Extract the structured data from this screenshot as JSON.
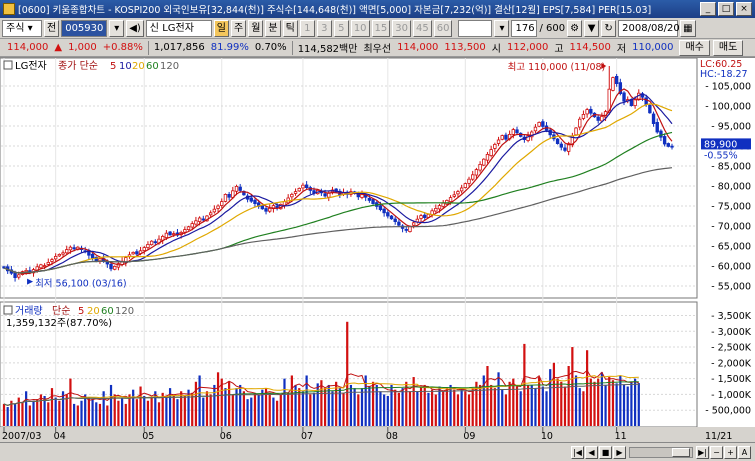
{
  "window": {
    "title": "[0600] 키움종합차트 - KOSPI200 외국인보유[32,844(천)] 주식수[144,648(천)] 액면[5,000] 자본금[7,232(억)] 결산[12월] EPS[7,584] PER[15.03]",
    "buttons": [
      "_",
      "□",
      "×"
    ]
  },
  "toolbar": {
    "market": "주식",
    "search_label": "전",
    "code": "005930",
    "stock_name_tag": "신",
    "stock_name": "LG전자",
    "period_sel": "일",
    "period_buttons": [
      "주",
      "월",
      "분",
      "틱"
    ],
    "minute_buttons": [
      "1",
      "3",
      "5",
      "10",
      "15",
      "30",
      "45",
      "60"
    ],
    "count": "176",
    "total": "/ 600",
    "date": "2008/08/20"
  },
  "infobar": {
    "price": "114,000",
    "change_arrow": "▲",
    "change": "1,000",
    "change_pct": "+0.88%",
    "volume": "1,017,856",
    "ratio1": "81.99%",
    "ratio2": "0.70%",
    "amount": "114,582백만",
    "best_label": "최우선",
    "best_ask": "114,000",
    "best_bid": "113,500",
    "open_label": "시",
    "open": "112,000",
    "high_label": "고",
    "high": "114,500",
    "low_label": "저",
    "low": "110,000",
    "buy_button": "매수",
    "sell_button": "매도"
  },
  "chart_data": [
    {
      "type": "candlestick",
      "title": "LG전자",
      "indicator_label": "종가 단순",
      "ma_periods": [
        "5",
        "10",
        "20",
        "60",
        "120"
      ],
      "ma_colors": [
        "#c01010",
        "#1a1aa0",
        "#e0a800",
        "#208020",
        "#606060"
      ],
      "y_ticks": [
        "105,000",
        "100,000",
        "95,000",
        "90,000",
        "85,000",
        "80,000",
        "75,000",
        "70,000",
        "65,000",
        "60,000",
        "55,000"
      ],
      "ylim": [
        53000,
        111000
      ],
      "lc_label": "LC:60.25",
      "hc_label": "HC:-18.27",
      "last_price_label": "89,900",
      "last_change_label": "-0.55%",
      "annotation_high": "최고 110,000 (11/08)",
      "annotation_low": "최저 56,100 (03/16)",
      "close": [
        59500,
        58800,
        58200,
        57100,
        57800,
        58600,
        58900,
        58400,
        59100,
        59800,
        60300,
        60100,
        60900,
        61600,
        62400,
        62900,
        63300,
        64100,
        64700,
        64300,
        64700,
        64100,
        63600,
        62700,
        62000,
        61200,
        61800,
        61200,
        60500,
        59300,
        59900,
        60600,
        61200,
        62100,
        62800,
        63400,
        63000,
        63800,
        64600,
        65400,
        66200,
        65900,
        66700,
        67400,
        68200,
        67800,
        68100,
        67700,
        68400,
        69100,
        69800,
        70600,
        71300,
        72000,
        71600,
        72500,
        73300,
        74200,
        75000,
        76100,
        77900,
        77200,
        78800,
        79900,
        78900,
        77800,
        76700,
        76200,
        75600,
        74900,
        74300,
        73700,
        74400,
        75100,
        74500,
        75400,
        76100,
        77000,
        77900,
        78600,
        79400,
        80200,
        79600,
        78900,
        78200,
        78900,
        78300,
        77500,
        78200,
        79000,
        78500,
        77800,
        78400,
        77900,
        78600,
        78100,
        77300,
        77900,
        77200,
        76400,
        75600,
        74900,
        74100,
        73300,
        72500,
        71800,
        71100,
        70200,
        69400,
        68900,
        69900,
        70800,
        71700,
        72600,
        72100,
        72900,
        73800,
        74400,
        75100,
        75700,
        76400,
        77100,
        77800,
        78600,
        79500,
        80600,
        81700,
        82800,
        84100,
        85400,
        86700,
        87900,
        89100,
        90400,
        91500,
        92600,
        91700,
        92900,
        94100,
        93300,
        92400,
        91600,
        92600,
        93500,
        94700,
        95900,
        94900,
        93900,
        92800,
        91800,
        90600,
        89700,
        88900,
        90600,
        92500,
        94500,
        96700,
        97900,
        99100,
        98200,
        97300,
        96400,
        97400,
        98600,
        104200,
        107100,
        105600,
        103100,
        101200,
        101600,
        100100,
        101800,
        103200,
        102200,
        100400,
        98300,
        95600,
        93500,
        92200,
        90500,
        89900,
        89900
      ],
      "low_point": {
        "index": 3,
        "value": 56100
      },
      "high_point": {
        "index": 164,
        "value": 110000
      }
    },
    {
      "type": "bar",
      "title": "거래량",
      "indicator_label": "단순",
      "ma_periods": [
        "5",
        "20",
        "60",
        "120"
      ],
      "ma_colors": [
        "#c01010",
        "#e0a800",
        "#208020",
        "#606060"
      ],
      "value_label": "1,359,132주(87.70%)",
      "y_ticks": [
        "3,500K",
        "3,000K",
        "2,500K",
        "2,000K",
        "1,500K",
        "1,000K",
        "500,000"
      ],
      "ylim": [
        0,
        3800000
      ],
      "values": [
        700000,
        600000,
        800000,
        700000,
        900000,
        750000,
        1100000,
        650000,
        800000,
        850000,
        1000000,
        950000,
        750000,
        1200000,
        900000,
        800000,
        1100000,
        1000000,
        1500000,
        700000,
        650000,
        800000,
        1000000,
        900000,
        850000,
        750000,
        700000,
        1100000,
        650000,
        1300000,
        1000000,
        800000,
        900000,
        700000,
        1000000,
        1150000,
        850000,
        1250000,
        950000,
        800000,
        900000,
        1100000,
        750000,
        1050000,
        950000,
        1200000,
        1000000,
        850000,
        1100000,
        950000,
        1150000,
        1050000,
        1400000,
        1600000,
        900000,
        1100000,
        1000000,
        1300000,
        1700000,
        1500000,
        1200000,
        1400000,
        1000000,
        1200000,
        1300000,
        1100000,
        850000,
        900000,
        1050000,
        1000000,
        1150000,
        1200000,
        1050000,
        900000,
        800000,
        1000000,
        1500000,
        1050000,
        1600000,
        1300000,
        1200000,
        1100000,
        1600000,
        1000000,
        1050000,
        1350000,
        1450000,
        1200000,
        1300000,
        1100000,
        1400000,
        1200000,
        1050000,
        3300000,
        1300000,
        1200000,
        1000000,
        1200000,
        1600000,
        1250000,
        1400000,
        1300000,
        1100000,
        1000000,
        950000,
        1300000,
        1150000,
        1050000,
        1200000,
        1400000,
        1100000,
        1550000,
        1100000,
        1250000,
        1300000,
        1050000,
        1150000,
        1000000,
        1250000,
        1100000,
        1200000,
        1300000,
        1150000,
        1000000,
        1200000,
        1100000,
        1000000,
        1200000,
        1400000,
        1300000,
        1600000,
        1900000,
        1300000,
        1200000,
        1700000,
        1150000,
        1000000,
        1400000,
        1500000,
        1250000,
        1100000,
        2600000,
        1300000,
        1300000,
        1200000,
        1550000,
        1250000,
        1100000,
        1800000,
        2000000,
        1500000,
        1400000,
        1250000,
        1900000,
        2500000,
        1600000,
        1200000,
        1100000,
        2400000,
        1500000,
        1400000,
        1500000,
        1700000,
        1300000,
        1550000,
        1450000,
        1350000,
        1600000,
        1300000,
        1250000,
        1400000,
        1500000,
        1359132
      ],
      "up": [
        1,
        0,
        1,
        0,
        1,
        1,
        0,
        1,
        0,
        1,
        1,
        0,
        1,
        1,
        0,
        1,
        0,
        1,
        1,
        0,
        1,
        0,
        0,
        1,
        0,
        0,
        1,
        0,
        1,
        0,
        1,
        1,
        0,
        1,
        1,
        0,
        1,
        1,
        0,
        1,
        1,
        0,
        1,
        1,
        0,
        0,
        1,
        0,
        1,
        1,
        0,
        1,
        1,
        0,
        0,
        1,
        1,
        0,
        1,
        1,
        0,
        1,
        1,
        0,
        0,
        1,
        0,
        0,
        1,
        0,
        0,
        1,
        1,
        0,
        1,
        1,
        0,
        1,
        1,
        0,
        1,
        0,
        0,
        1,
        0,
        0,
        1,
        1,
        0,
        0,
        1,
        0,
        1,
        1,
        0,
        0,
        1,
        0,
        0,
        0,
        1,
        0,
        0,
        0,
        0,
        0,
        1,
        1,
        0,
        1,
        1,
        1,
        0,
        1,
        1,
        0,
        1,
        1,
        0,
        1,
        1,
        0,
        1,
        1,
        0,
        1,
        1,
        1,
        1,
        1,
        0,
        1,
        1,
        1,
        0,
        0,
        1,
        1,
        1,
        1,
        0,
        1,
        1,
        0,
        0,
        1,
        0,
        0,
        0,
        1,
        1,
        1,
        1,
        1,
        1,
        0,
        0,
        1,
        1,
        1,
        1,
        1,
        0,
        0,
        1,
        1,
        0,
        0,
        0,
        0,
        0,
        0,
        0
      ]
    }
  ],
  "x_axis": {
    "labels": [
      "2007/03",
      "04",
      "05",
      "06",
      "07",
      "08",
      "09",
      "10",
      "11"
    ],
    "label_index": [
      0,
      14,
      38,
      59,
      81,
      104,
      125,
      146,
      166
    ],
    "right_label": "11/21"
  }
}
